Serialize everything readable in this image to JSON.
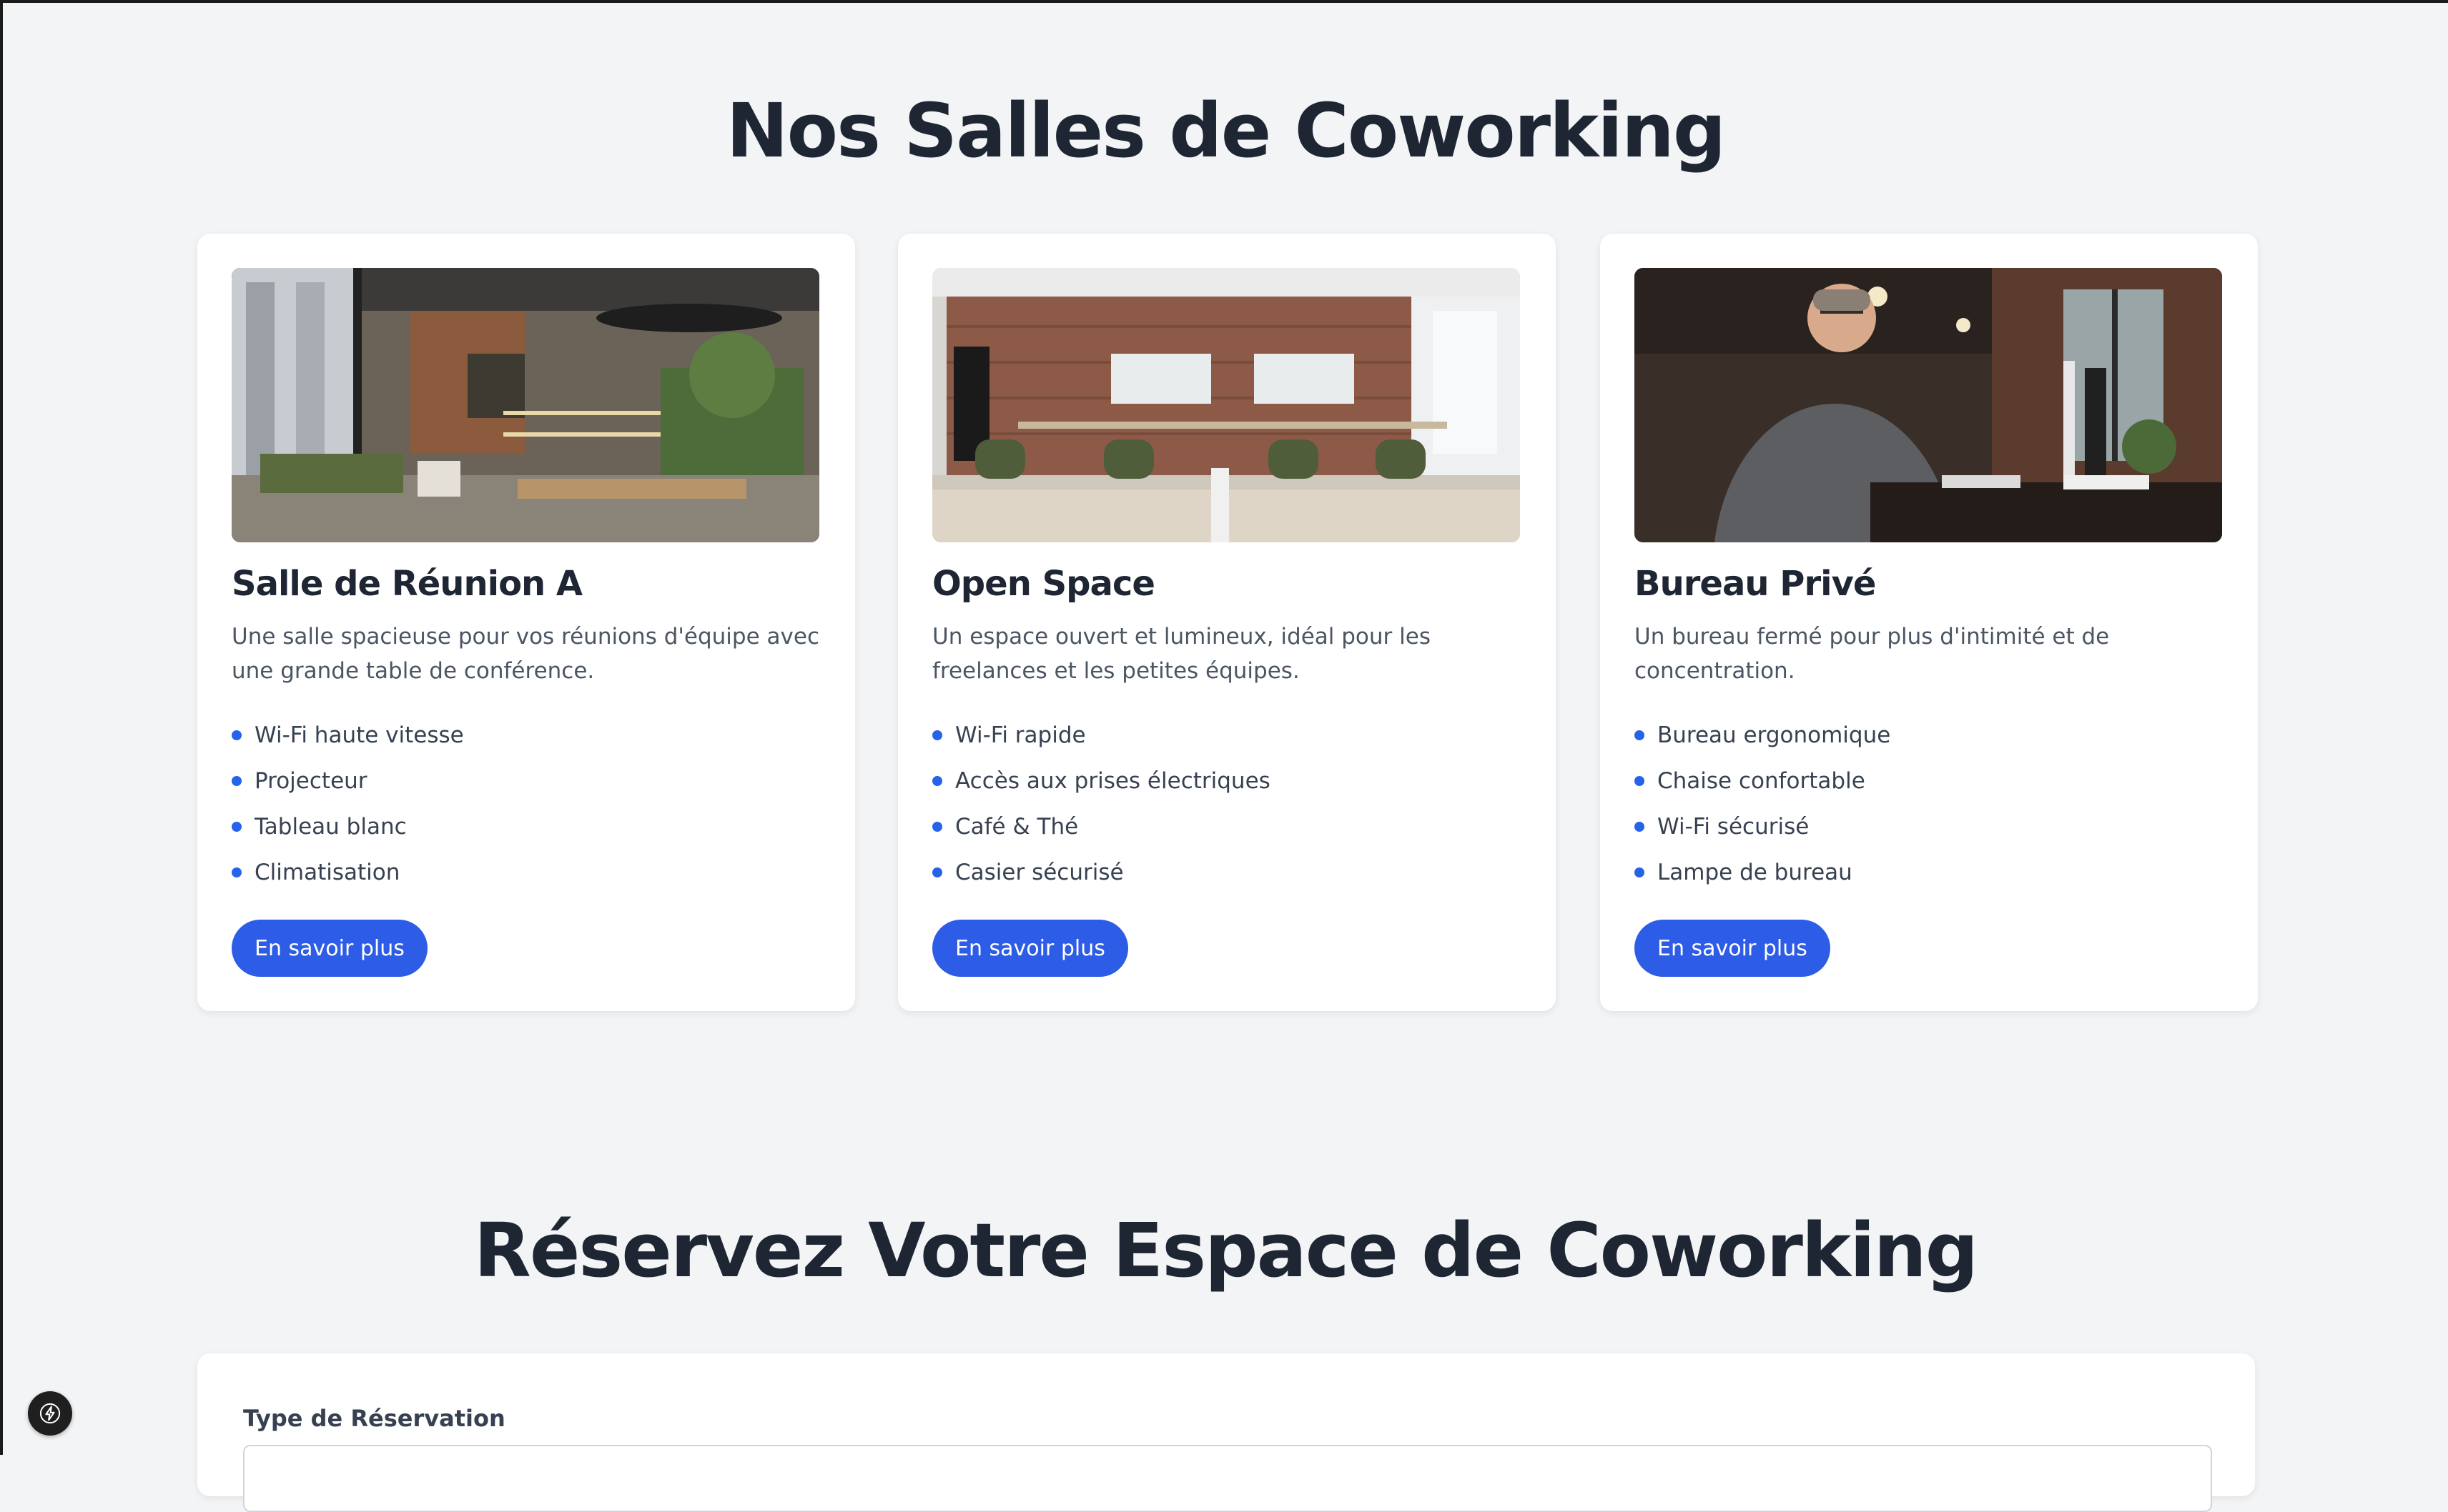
{
  "rooms_section": {
    "title": "Nos Salles de Coworking"
  },
  "cards": [
    {
      "title": "Salle de Réunion A",
      "description": "Une salle spacieuse pour vos réunions d'équipe avec une grande table de conférence.",
      "features": [
        "Wi-Fi haute vitesse",
        "Projecteur",
        "Tableau blanc",
        "Climatisation"
      ],
      "button_label": "En savoir plus"
    },
    {
      "title": "Open Space",
      "description": "Un espace ouvert et lumineux, idéal pour les freelances et les petites équipes.",
      "features": [
        "Wi-Fi rapide",
        "Accès aux prises électriques",
        "Café & Thé",
        "Casier sécurisé"
      ],
      "button_label": "En savoir plus"
    },
    {
      "title": "Bureau Privé",
      "description": "Un bureau fermé pour plus d'intimité et de concentration.",
      "features": [
        "Bureau ergonomique",
        "Chaise confortable",
        "Wi-Fi sécurisé",
        "Lampe de bureau"
      ],
      "button_label": "En savoir plus"
    }
  ],
  "booking_section": {
    "title": "Réservez Votre Espace de Coworking",
    "reservation_type_label": "Type de Réservation"
  },
  "colors": {
    "accent": "#2d5ce6",
    "background": "#f3f4f6",
    "heading": "#1e2533"
  },
  "icons": {
    "dev_tools": "lightning-icon"
  }
}
